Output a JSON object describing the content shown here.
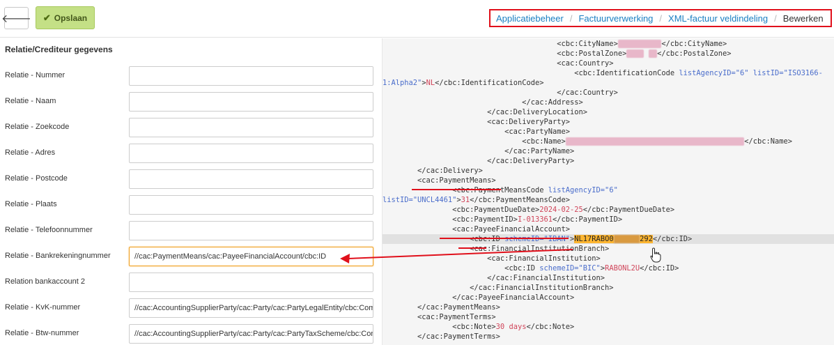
{
  "toolbar": {
    "back_icon": "arrow-left-icon",
    "save_label": "Opslaan",
    "save_icon": "check-icon",
    "accent_color": "#c4e086"
  },
  "breadcrumb": {
    "items": [
      "Applicatiebeheer",
      "Factuurverwerking",
      "XML-factuur veldindeling"
    ],
    "current": "Bewerken",
    "separator": "/",
    "highlight_color": "#e0101b"
  },
  "form": {
    "section_title": "Relatie/Crediteur gegevens",
    "fields": [
      {
        "label": "Relatie - Nummer",
        "value": ""
      },
      {
        "label": "Relatie - Naam",
        "value": ""
      },
      {
        "label": "Relatie - Zoekcode",
        "value": ""
      },
      {
        "label": "Relatie - Adres",
        "value": ""
      },
      {
        "label": "Relatie - Postcode",
        "value": ""
      },
      {
        "label": "Relatie - Plaats",
        "value": ""
      },
      {
        "label": "Relatie - Telefoonnummer",
        "value": ""
      },
      {
        "label": "Relatie - Bankrekeningnummer",
        "value": "//cac:PaymentMeans/cac:PayeeFinancialAccount/cbc:ID"
      },
      {
        "label": "Relation bankaccount 2",
        "value": ""
      },
      {
        "label": "Relatie - KvK-nummer",
        "value": "//cac:AccountingSupplierParty/cac:Party/cac:PartyLegalEntity/cbc:CompanyID"
      },
      {
        "label": "Relatie - Btw-nummer",
        "value": "//cac:AccountingSupplierParty/cac:Party/cac:PartyTaxScheme/cbc:CompanyID"
      }
    ]
  },
  "xml": {
    "lines": [
      [
        {
          "t": "            <cbc:CityName>"
        },
        {
          "r": "xxxxxxxxxx"
        },
        {
          "t": "</cbc:CityName>"
        }
      ],
      [
        {
          "t": "            <cbc:PostalZone>"
        },
        {
          "r": "xxxx"
        },
        {
          "t": " "
        },
        {
          "r": "xx"
        },
        {
          "t": "</cbc:PostalZone>"
        }
      ],
      [
        {
          "t": "            <cac:Country>"
        }
      ],
      [
        {
          "t": "                <cbc:IdentificationCode "
        },
        {
          "a": "listAgencyID="
        },
        {
          "a": "\"6\""
        },
        {
          "t": " "
        },
        {
          "a": "listID="
        },
        {
          "a": "\"ISO3166-"
        }
      ],
      [
        {
          "a": "1:Alpha2\""
        },
        {
          "t": ">"
        },
        {
          "v": "NL"
        },
        {
          "t": "</cbc:IdentificationCode>"
        }
      ],
      [
        {
          "t": "            </cac:Country>"
        }
      ],
      [
        {
          "t": "        </cac:Address>"
        }
      ],
      [
        {
          "t": "    </cac:DeliveryLocation>"
        }
      ],
      [
        {
          "t": "    <cac:DeliveryParty>"
        }
      ],
      [
        {
          "t": "        <cac:PartyName>"
        }
      ],
      [
        {
          "t": "            <cbc:Name>"
        },
        {
          "r": "xxxxxxxxxxxxxxxxxxxxxxxxxxxxxxxxxxxxxxxxx"
        },
        {
          "t": "</cbc:Name>"
        }
      ],
      [
        {
          "t": "        </cac:PartyName>"
        }
      ],
      [
        {
          "t": "    </cac:DeliveryParty>"
        }
      ],
      [
        {
          "t": "</cac:Delivery>"
        }
      ],
      [
        {
          "t": "<cac:PaymentMeans>"
        }
      ],
      [
        {
          "t": "    <cbc:PaymentMeansCode "
        },
        {
          "a": "listAgencyID=\"6\""
        }
      ],
      [
        {
          "a": "listID=\"UNCL4461\""
        },
        {
          "t": ">"
        },
        {
          "v": "31"
        },
        {
          "t": "</cbc:PaymentMeansCode>"
        }
      ],
      [
        {
          "t": "    <cbc:PaymentDueDate>"
        },
        {
          "v": "2024-02-25"
        },
        {
          "t": "</cbc:PaymentDueDate>"
        }
      ],
      [
        {
          "t": "    <cbc:PaymentID>"
        },
        {
          "v": "I-013361"
        },
        {
          "t": "</cbc:PaymentID>"
        }
      ],
      [
        {
          "t": "    <cac:PayeeFinancialAccount>"
        }
      ],
      [
        {
          "t": "        <cbc:ID "
        },
        {
          "a": "schemeID=\"IBAN\""
        },
        {
          "t": ">"
        },
        {
          "s": "NL17RABO0"
        },
        {
          "sb": "xxxxxx"
        },
        {
          "s": "292"
        },
        {
          "t": "</cbc:ID>"
        }
      ],
      [
        {
          "t": "        <cac:FinancialInstitutionBranch>"
        }
      ],
      [
        {
          "t": "            <cac:FinancialInstitution>"
        }
      ],
      [
        {
          "t": "                <cbc:ID "
        },
        {
          "a": "schemeID=\"BIC\""
        },
        {
          "t": ">"
        },
        {
          "v": "RABONL2U"
        },
        {
          "t": "</cbc:ID>"
        }
      ],
      [
        {
          "t": "            </cac:FinancialInstitution>"
        }
      ],
      [
        {
          "t": "        </cac:FinancialInstitutionBranch>"
        }
      ],
      [
        {
          "t": "    </cac:PayeeFinancialAccount>"
        }
      ],
      [
        {
          "t": "</cac:PaymentMeans>"
        }
      ],
      [
        {
          "t": "<cac:PaymentTerms>"
        }
      ],
      [
        {
          "t": "    <cbc:Note>"
        },
        {
          "v": "30 days"
        },
        {
          "t": "</cbc:Note>"
        }
      ],
      [
        {
          "t": "</cac:PaymentTerms>"
        }
      ]
    ],
    "indent_base": [
      "                            ",
      "                            ",
      "                            ",
      "                            ",
      "",
      "                            ",
      "                        ",
      "                    ",
      "                    ",
      "                    ",
      "                    ",
      "                    ",
      "                    ",
      "        ",
      "        ",
      "            ",
      "",
      "            ",
      "            ",
      "            ",
      "            ",
      "            ",
      "            ",
      "            ",
      "            ",
      "            ",
      "            ",
      "        ",
      "        ",
      "            ",
      "        "
    ],
    "highlighted_line": 20,
    "annotation_color": "#e0101b"
  }
}
